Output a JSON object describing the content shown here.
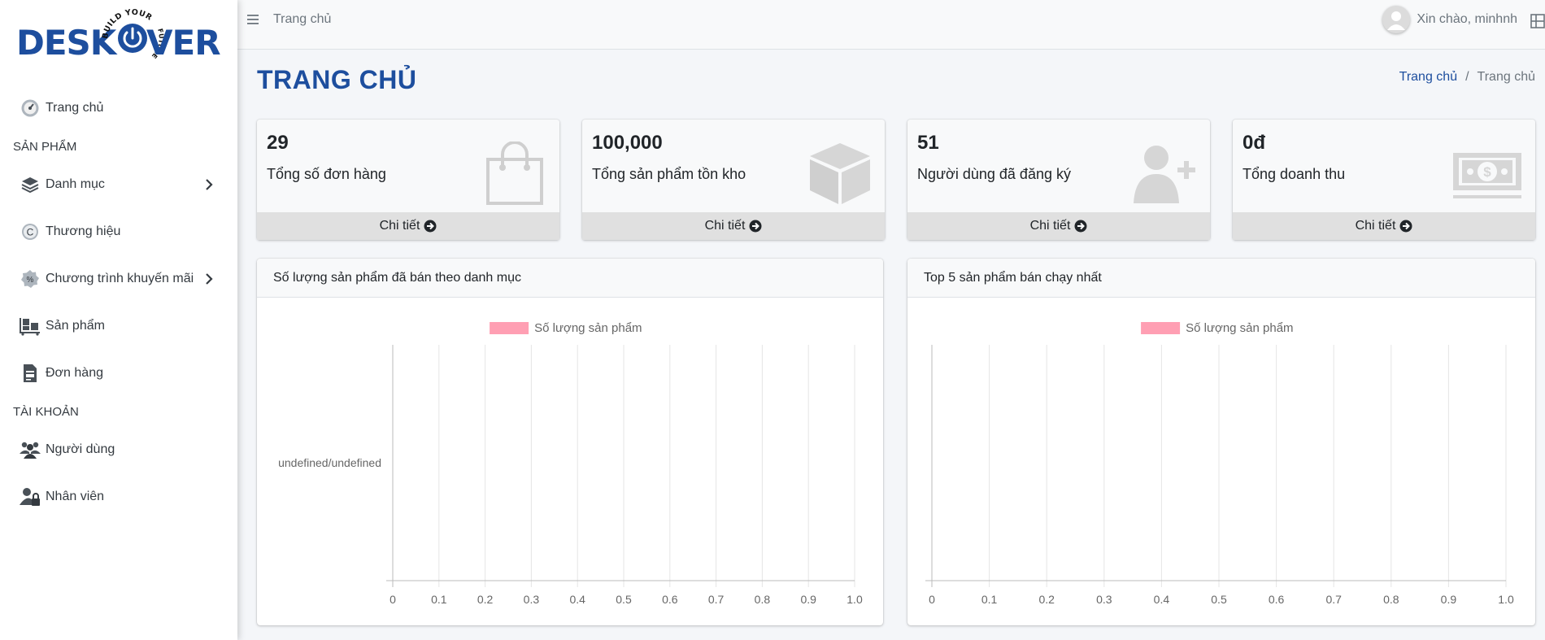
{
  "brand": {
    "logo_left": "DESK",
    "logo_right": "VER",
    "tagline": "BUILD YOUR FUTURE",
    "color": "#1d4e9e"
  },
  "topbar": {
    "home_link": "Trang chủ",
    "greeting": "Xin chào, minhnh"
  },
  "sidebar": {
    "home": "Trang chủ",
    "section_products": "SẢN PHẨM",
    "categories": "Danh mục",
    "brands": "Thương hiệu",
    "promotions": "Chương trình khuyến mãi",
    "products": "Sản phẩm",
    "orders": "Đơn hàng",
    "section_account": "TÀI KHOẢN",
    "users": "Người dùng",
    "employees": "Nhân viên"
  },
  "page": {
    "title": "TRANG CHỦ",
    "breadcrumb": [
      "Trang chủ",
      "/",
      "Trang chủ"
    ]
  },
  "stats": [
    {
      "value": "29",
      "label": "Tổng số đơn hàng",
      "link": "Chi tiết",
      "icon": "shopping-bag-icon"
    },
    {
      "value": "100,000",
      "label": "Tổng sản phẩm tồn kho",
      "link": "Chi tiết",
      "icon": "box-icon"
    },
    {
      "value": "51",
      "label": "Người dùng đã đăng ký",
      "link": "Chi tiết",
      "icon": "user-plus-icon"
    },
    {
      "value": "0đ",
      "label": "Tổng doanh thu",
      "link": "Chi tiết",
      "icon": "money-bill-icon"
    }
  ],
  "cards": {
    "left_title": "Số lượng sản phẩm đã bán theo danh mục",
    "right_title": "Top 5 sản phẩm bán chạy nhất"
  },
  "chart_data": [
    {
      "type": "bar",
      "orientation": "horizontal",
      "title": "",
      "legend": [
        "Số lượng sản phẩm"
      ],
      "legend_color": "#ff9fb3",
      "legend_position": "top",
      "categories": [
        "undefined/undefined"
      ],
      "series": [
        {
          "name": "Số lượng sản phẩm",
          "values": [
            0
          ]
        }
      ],
      "xlim": [
        0,
        1.0
      ],
      "x_ticks": [
        "0",
        "0.1",
        "0.2",
        "0.3",
        "0.4",
        "0.5",
        "0.6",
        "0.7",
        "0.8",
        "0.9",
        "1.0"
      ],
      "grid": true
    },
    {
      "type": "bar",
      "orientation": "horizontal",
      "title": "",
      "legend": [
        "Số lượng sản phẩm"
      ],
      "legend_color": "#ff9fb3",
      "legend_position": "top",
      "categories": [],
      "series": [
        {
          "name": "Số lượng sản phẩm",
          "values": []
        }
      ],
      "xlim": [
        0,
        1.0
      ],
      "x_ticks": [
        "0",
        "0.1",
        "0.2",
        "0.3",
        "0.4",
        "0.5",
        "0.6",
        "0.7",
        "0.8",
        "0.9",
        "1.0"
      ],
      "grid": true
    }
  ]
}
